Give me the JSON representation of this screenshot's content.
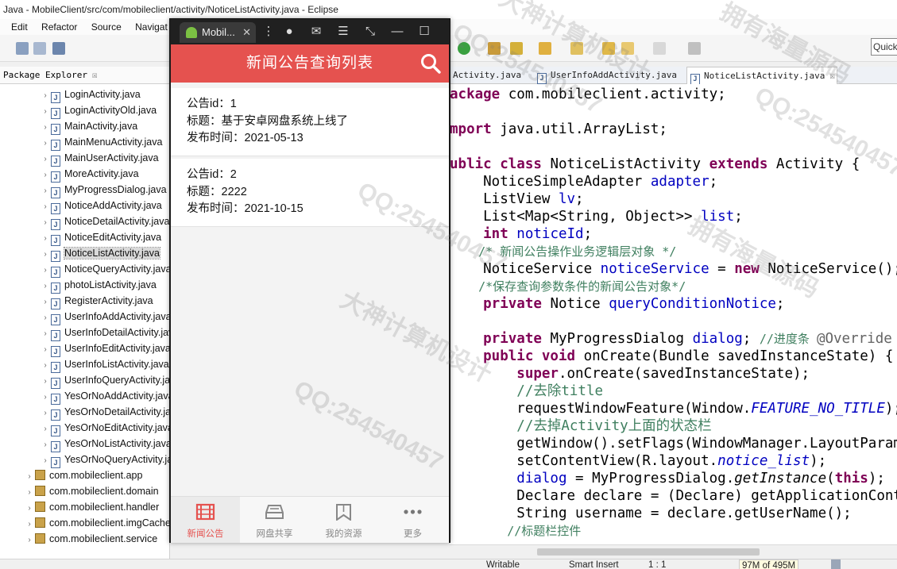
{
  "eclipse": {
    "title": "Java - MobileClient/src/com/mobileclient/activity/NoticeListActivity.java - Eclipse",
    "menu": [
      "Edit",
      "Refactor",
      "Source",
      "Navigat"
    ],
    "quick_access": "Quick",
    "package_explorer": {
      "tab_label": "Package Explorer",
      "tab_close": "☒",
      "files": [
        "LoginActivity.java",
        "LoginActivityOld.java",
        "MainActivity.java",
        "MainMenuActivity.java",
        "MainUserActivity.java",
        "MoreActivity.java",
        "MyProgressDialog.java",
        "NoticeAddActivity.java",
        "NoticeDetailActivity.java",
        "NoticeEditActivity.java",
        "NoticeListActivity.java",
        "NoticeQueryActivity.java",
        "photoListActivity.java",
        "RegisterActivity.java",
        "UserInfoAddActivity.java",
        "UserInfoDetailActivity.java",
        "UserInfoEditActivity.java",
        "UserInfoListActivity.java",
        "UserInfoQueryActivity.java",
        "YesOrNoAddActivity.java",
        "YesOrNoDetailActivity.java",
        "YesOrNoEditActivity.java",
        "YesOrNoListActivity.java",
        "YesOrNoQueryActivity.java"
      ],
      "selected_file": "NoticeListActivity.java",
      "packages": [
        "com.mobileclient.app",
        "com.mobileclient.domain",
        "com.mobileclient.handler",
        "com.mobileclient.imgCache",
        "com.mobileclient.service"
      ]
    },
    "editor_tabs": [
      {
        "label": "Activity.java",
        "active": false
      },
      {
        "label": "UserInfoAddActivity.java",
        "active": false
      },
      {
        "label": "NoticeListActivity.java",
        "active": true
      }
    ],
    "code": {
      "l1_kw": "ackage",
      "l1_rest": " com.mobileclient.activity;",
      "l2_kw": "mport",
      "l2_rest": " java.util.ArrayList;",
      "l3_kw1": "ublic class",
      "l3_mid": " NoticeListActivity ",
      "l3_kw2": "extends",
      "l3_rest": " Activity {",
      "l4_type": "    NoticeSimpleAdapter ",
      "l4_fld": "adapter",
      "l4_end": ";",
      "l5_type": "    ListView ",
      "l5_fld": "lv",
      "l5_end": ";",
      "l6_type": "    List<Map<String, Object>> ",
      "l6_fld": "list",
      "l6_end": ";",
      "l7_kw": "    int",
      "l7_fld": " noticeId",
      "l7_end": ";",
      "l8_cm": "    /* 新闻公告操作业务逻辑层对象 */",
      "l9_type": "    NoticeService ",
      "l9_fld": "noticeService",
      "l9_mid": " = ",
      "l9_kw": "new",
      "l9_rest": " NoticeService();",
      "l10_cm": "    /*保存查询参数条件的新闻公告对象*/",
      "l11_kw": "    private",
      "l11_type": " Notice ",
      "l11_fld": "queryConditionNotice",
      "l11_end": ";",
      "l12_kw": "    private",
      "l12_type": " MyProgressDialog ",
      "l12_fld": "dialog",
      "l12_end": "; ",
      "l12_cm": "//进度条 ",
      "l12_anno": "@Override",
      "l13_kw": "    public void",
      "l13_rest": " onCreate(Bundle savedInstanceState) {",
      "l14_kw": "        super",
      "l14_rest": ".onCreate(savedInstanceState);",
      "l15_cm": "        //去除title",
      "l16_pre": "        requestWindowFeature(Window.",
      "l16_it": "FEATURE_NO_TITLE",
      "l16_end": ");",
      "l17_cm": "        //去掉Activity上面的状态栏",
      "l18": "        getWindow().setFlags(WindowManager.LayoutParams",
      "l19_pre": "        setContentView(R.layout.",
      "l19_it": "notice_list",
      "l19_end": ");",
      "l20_fld": "        dialog",
      "l20_mid": " = MyProgressDialog.",
      "l20_it": "getInstance",
      "l20_open": "(",
      "l20_kw": "this",
      "l20_end": ");",
      "l21": "        Declare declare = (Declare) getApplicationContext",
      "l22": "        String username = declare.getUserName();",
      "l23_cm": "        //标题栏控件"
    },
    "status": {
      "writable": "Writable",
      "insert_mode": "Smart Insert",
      "position": "1 : 1",
      "memory": "97M of 495M"
    }
  },
  "emulator": {
    "window_tab": "Mobil...",
    "window_tab_close": "✕",
    "app_title": "新闻公告查询列表",
    "notices": [
      {
        "id_line": "公告id：1",
        "title_line": "标题：基于安卓网盘系统上线了",
        "date_line": "发布时间：2021-05-13"
      },
      {
        "id_line": "公告id：2",
        "title_line": "标题：2222",
        "date_line": "发布时间：2021-10-15"
      }
    ],
    "bottom_nav": [
      {
        "label": "新闻公告",
        "icon": "film-icon",
        "active": true
      },
      {
        "label": "网盘共享",
        "icon": "tray-icon",
        "active": false
      },
      {
        "label": "我的资源",
        "icon": "bookmark-icon",
        "active": false
      },
      {
        "label": "更多",
        "icon": "more-dots-icon",
        "active": false
      }
    ],
    "accent_color": "#e5524f"
  },
  "watermark": [
    "QQ:254540457",
    "大神计算机设计",
    "拥有海量源码"
  ]
}
